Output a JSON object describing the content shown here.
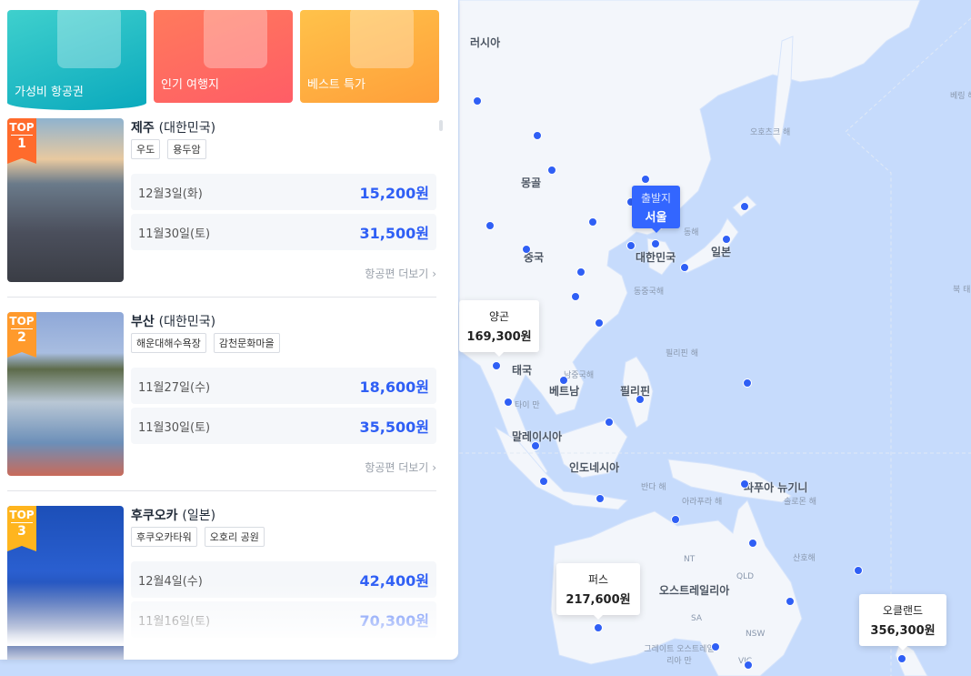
{
  "banners": [
    {
      "label": "가성비 항공권"
    },
    {
      "label": "인기 여행지"
    },
    {
      "label": "베스트 특가"
    }
  ],
  "cards": [
    {
      "rank_label": "TOP",
      "rank": "1",
      "city": "제주",
      "country": "(대한민국)",
      "tags": [
        "우도",
        "용두암"
      ],
      "fares": [
        {
          "date": "12월3일(화)",
          "price": "15,200원"
        },
        {
          "date": "11월30일(토)",
          "price": "31,500원"
        }
      ],
      "more": "항공편 더보기",
      "badge_color": "#ff6b2c"
    },
    {
      "rank_label": "TOP",
      "rank": "2",
      "city": "부산",
      "country": "(대한민국)",
      "tags": [
        "해운대해수욕장",
        "감천문화마을"
      ],
      "fares": [
        {
          "date": "11월27일(수)",
          "price": "18,600원"
        },
        {
          "date": "11월30일(토)",
          "price": "35,500원"
        }
      ],
      "more": "항공편 더보기",
      "badge_color": "#ff9a2c"
    },
    {
      "rank_label": "TOP",
      "rank": "3",
      "city": "후쿠오카",
      "country": "(일본)",
      "tags": [
        "후쿠오카타워",
        "오호리 공원"
      ],
      "fares": [
        {
          "date": "12월4일(수)",
          "price": "42,400원"
        },
        {
          "date": "11월16일(토)",
          "price": "70,300원"
        }
      ],
      "badge_color": "#ffb51e"
    }
  ],
  "map": {
    "origin": {
      "label": "출발지",
      "city": "서울"
    },
    "price_tips": [
      {
        "city": "양곤",
        "price": "169,300원"
      },
      {
        "city": "퍼스",
        "price": "217,600원"
      },
      {
        "city": "오클랜드",
        "price": "356,300원"
      }
    ],
    "country_labels": [
      "러시아",
      "몽골",
      "중국",
      "대한민국",
      "일본",
      "태국",
      "베트남",
      "필리핀",
      "말레이시아",
      "인도네시아",
      "파푸아 뉴기니",
      "오스트레일리아"
    ],
    "sea_labels": [
      "베링 해",
      "오호츠크 해",
      "동해",
      "동중국해",
      "필리핀 해",
      "남중국해",
      "타이 만",
      "반다 해",
      "아라푸라 해",
      "솔로몬 해",
      "산호해",
      "그레이트 오스트레일리아 만",
      "북 태"
    ],
    "region_labels": [
      "NT",
      "QLD",
      "SA",
      "NSW",
      "VIC"
    ],
    "colors": {
      "accent": "#2f5ff5",
      "sea": "#c6dbfc",
      "land": "#f3f6fb"
    }
  }
}
